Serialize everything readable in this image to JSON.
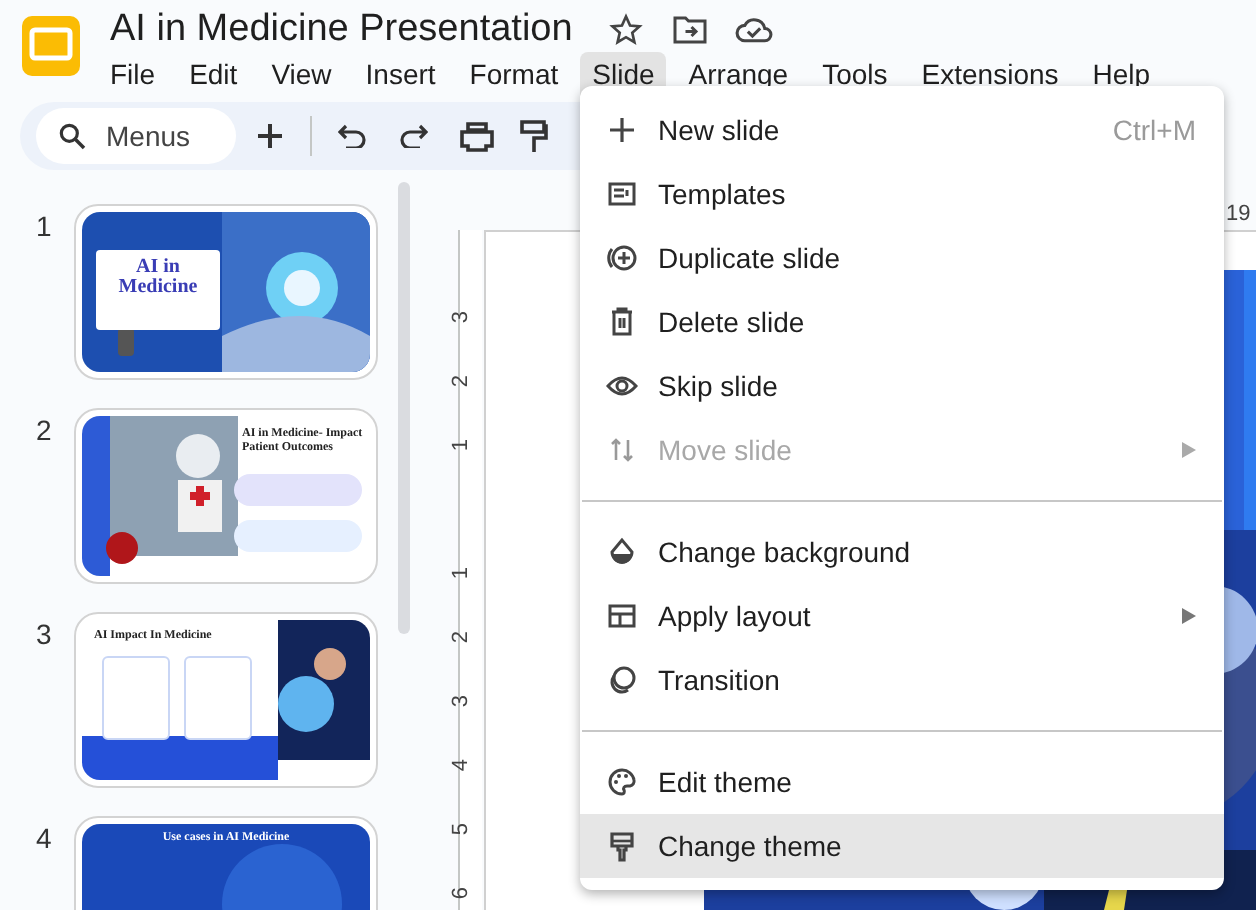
{
  "window": {
    "title": "AI in Medicine Presentation"
  },
  "menu_bar": [
    {
      "label": "File",
      "selected": false
    },
    {
      "label": "Edit",
      "selected": false
    },
    {
      "label": "View",
      "selected": false
    },
    {
      "label": "Insert",
      "selected": false
    },
    {
      "label": "Format",
      "selected": false
    },
    {
      "label": "Slide",
      "selected": true
    },
    {
      "label": "Arrange",
      "selected": false
    },
    {
      "label": "Tools",
      "selected": false
    },
    {
      "label": "Extensions",
      "selected": false
    },
    {
      "label": "Help",
      "selected": false
    }
  ],
  "toolbar": {
    "search": {
      "placeholder": "Menus"
    }
  },
  "slides": [
    {
      "number": "1",
      "kind": "title",
      "title": "AI in Medicine"
    },
    {
      "number": "2",
      "kind": "image-left",
      "title": "AI in Medicine- Impact Patient Outcomes"
    },
    {
      "number": "3",
      "kind": "cards",
      "title": "AI Impact In Medicine"
    },
    {
      "number": "4",
      "kind": "banner",
      "title": "Use cases in AI Medicine"
    }
  ],
  "ruler": {
    "horizontal": [
      "19"
    ],
    "vertical": [
      "3",
      "2",
      "1",
      "1",
      "2",
      "3",
      "4",
      "5",
      "6"
    ]
  },
  "slide_menu": {
    "groups": [
      [
        {
          "label": "New slide",
          "shortcut": "Ctrl+M",
          "submenu": false,
          "disabled": false,
          "selected": false
        },
        {
          "label": "Templates",
          "submenu": false,
          "disabled": false,
          "selected": false
        },
        {
          "label": "Duplicate slide",
          "submenu": false,
          "disabled": false,
          "selected": false
        },
        {
          "label": "Delete slide",
          "submenu": false,
          "disabled": false,
          "selected": false
        },
        {
          "label": "Skip slide",
          "submenu": false,
          "disabled": false,
          "selected": false
        },
        {
          "label": "Move slide",
          "submenu": true,
          "disabled": true,
          "selected": false
        }
      ],
      [
        {
          "label": "Change background",
          "submenu": false,
          "disabled": false,
          "selected": false
        },
        {
          "label": "Apply layout",
          "submenu": true,
          "disabled": false,
          "selected": false
        },
        {
          "label": "Transition",
          "submenu": false,
          "disabled": false,
          "selected": false
        }
      ],
      [
        {
          "label": "Edit theme",
          "submenu": false,
          "disabled": false,
          "selected": false
        },
        {
          "label": "Change theme",
          "submenu": false,
          "disabled": false,
          "selected": true
        }
      ]
    ]
  }
}
